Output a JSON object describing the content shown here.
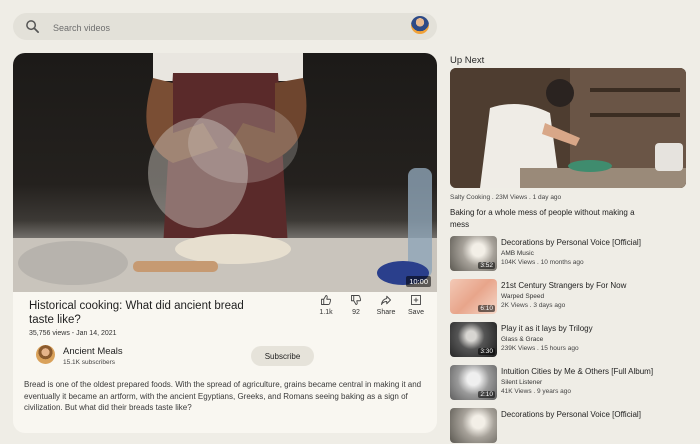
{
  "search": {
    "placeholder": "Search videos"
  },
  "player": {
    "duration": "10:00"
  },
  "video": {
    "title": "Historical cooking: What did ancient bread taste like?",
    "views_date": "35,756 views - Jan 14, 2021",
    "channel_name": "Ancient Meals",
    "channel_subs": "15.1K subscribers",
    "subscribe_label": "Subscribe",
    "description": "Bread is one of the oldest prepared foods. With the spread of agriculture, grains became central in making it and eventually it became an artform, with the ancient Egyptians, Greeks, and Romans seeing baking as a sign of civilization. But what did their breads taste like?"
  },
  "actions": {
    "like_count": "1.1k",
    "dislike_count": "92",
    "share_label": "Share",
    "save_label": "Save"
  },
  "up_next": {
    "heading": "Up Next",
    "featured": {
      "meta": "Salty Cooking . 23M Views . 1 day ago",
      "title": "Baking for a whole mess of people without making a mess"
    },
    "items": [
      {
        "title": "Decorations by Personal Voice [Official]",
        "channel": "AMB Music",
        "meta": "104K Views . 10 months ago",
        "duration": "3:52"
      },
      {
        "title": "21st Century Strangers by For Now",
        "channel": "Warped Speed",
        "meta": "2K Views . 3 days ago",
        "duration": "6:10"
      },
      {
        "title": "Play it as it lays by Trilogy",
        "channel": "Glass & Grace",
        "meta": "239K Views . 15 hours ago",
        "duration": "3:30"
      },
      {
        "title": "Intuition Cities by Me & Others [Full Album]",
        "channel": "Silent Listener",
        "meta": "41K Views . 9 years ago",
        "duration": "2:10"
      },
      {
        "title": "Decorations by Personal Voice [Official]",
        "channel": "",
        "meta": "",
        "duration": ""
      }
    ]
  }
}
